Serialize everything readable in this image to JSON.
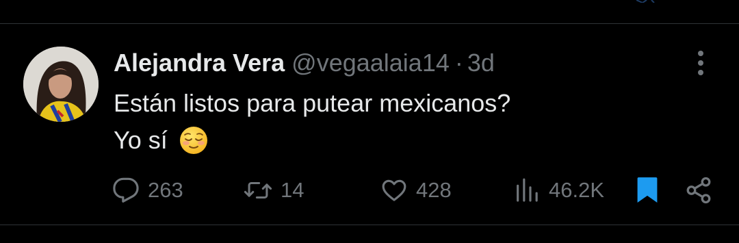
{
  "tweet": {
    "author_name": "Alejandra Vera",
    "handle": "@vegaalaia14",
    "separator": "·",
    "time": "3d",
    "text_lines": [
      "Están listos para putear mexicanos?",
      "Yo sí"
    ],
    "emoji": "relieved-face-emoji"
  },
  "actions": {
    "reply_count": "263",
    "retweet_count": "14",
    "like_count": "428",
    "views_count": "46.2K"
  },
  "colors": {
    "background": "#000000",
    "primary_text": "#e7e9ea",
    "secondary_text": "#71767b",
    "divider": "#2f3336",
    "bookmark_active": "#1d9bf0"
  },
  "icons": [
    "more-icon",
    "reply-icon",
    "retweet-icon",
    "like-icon",
    "views-icon",
    "bookmark-icon",
    "share-icon"
  ]
}
